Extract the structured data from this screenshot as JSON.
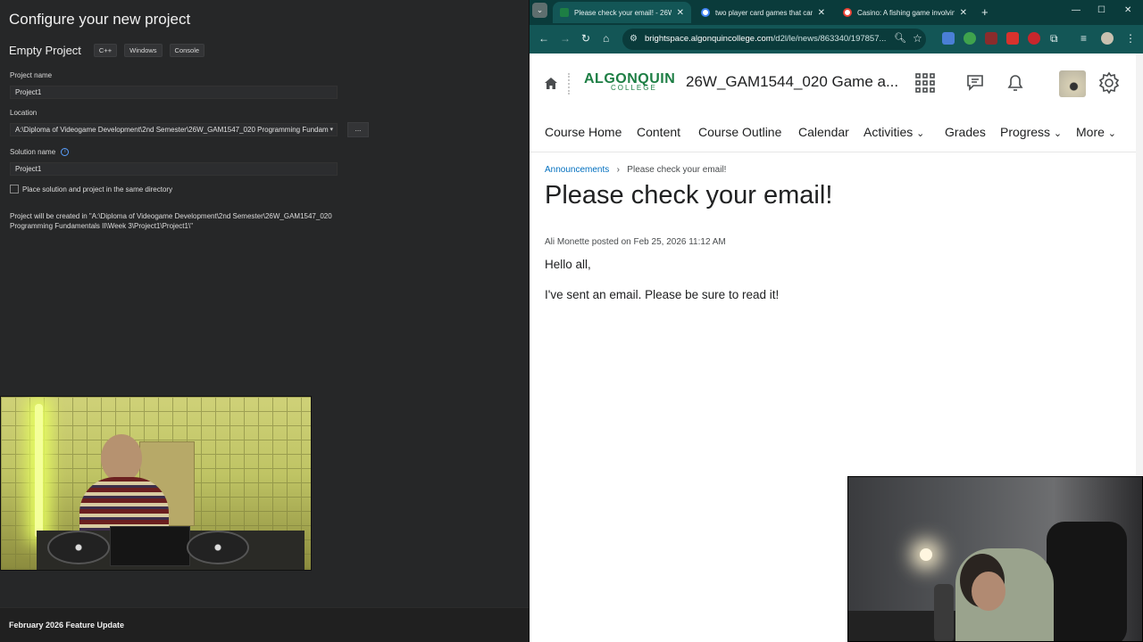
{
  "vs": {
    "title": "Configure your new project",
    "template_name": "Empty Project",
    "tags": [
      "C++",
      "Windows",
      "Console"
    ],
    "project_name_label": "Project name",
    "project_name_value": "Project1",
    "location_label": "Location",
    "location_value": "A:\\Diploma of Videogame Development\\2nd Semester\\26W_GAM1547_020 Programming Fundam",
    "browse_label": "...",
    "solution_name_label": "Solution name",
    "solution_name_value": "Project1",
    "same_dir_label": "Place solution and project in the same directory",
    "same_dir_checked": false,
    "created_note": "Project will be created in \"A:\\Diploma of Videogame Development\\2nd Semester\\26W_GAM1547_020 Programming Fundamentals II\\Week 3\\Project1\\Project1\\\"",
    "footer": "February 2026 Feature Update"
  },
  "browser": {
    "tabs": [
      {
        "label": "Please check your email! - 26W",
        "active": true,
        "favicon_color": "#1d7e44"
      },
      {
        "label": "two player card games that can",
        "active": false,
        "favicon_color": "#ffffff"
      },
      {
        "label": "Casino: A fishing game involvin",
        "active": false,
        "favicon_color": "#ffffff"
      }
    ],
    "url_host": "brightspace.algonquincollege.com",
    "url_path": "/d2l/le/news/863340/197857..."
  },
  "page": {
    "logo_top": "ALGONQUIN",
    "logo_bottom": "COLLEGE",
    "course_title": "26W_GAM1544_020 Game a...",
    "nav": [
      "Course Home",
      "Content",
      "Course Outline",
      "Calendar",
      "Activities",
      "Grades",
      "Progress",
      "More"
    ],
    "breadcrumb_link": "Announcements",
    "breadcrumb_current": "Please check your email!",
    "heading": "Please check your email!",
    "meta": "Ali Monette posted on Feb 25, 2026 11:12 AM",
    "para1": "Hello all,",
    "para2": "I've sent an email. Please be sure to read it!"
  }
}
